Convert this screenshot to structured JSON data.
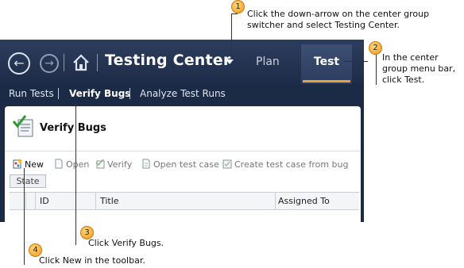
{
  "header": {
    "center_name": "Testing Center",
    "menu": [
      {
        "label": "Plan",
        "selected": false
      },
      {
        "label": "Test",
        "selected": true
      }
    ]
  },
  "subnav": {
    "items": [
      {
        "label": "Run Tests",
        "active": false
      },
      {
        "label": "Verify Bugs",
        "active": true
      },
      {
        "label": "Analyze Test Runs",
        "active": false
      }
    ]
  },
  "panel": {
    "title": "Verify Bugs",
    "toolbar": [
      {
        "label": "New",
        "icon": "new-icon",
        "enabled": true
      },
      {
        "label": "Open",
        "icon": "open-icon",
        "enabled": false
      },
      {
        "label": "Verify",
        "icon": "verify-icon",
        "enabled": false
      },
      {
        "label": "Open test case",
        "icon": "open-test-case-icon",
        "enabled": false
      },
      {
        "label": "Create test case from bug",
        "icon": "create-test-case-icon",
        "enabled": false
      }
    ],
    "state_tab": "State",
    "columns": [
      "ID",
      "Title",
      "Assigned To"
    ]
  },
  "callouts": [
    {
      "number": "1",
      "text": "Click the down-arrow on the center group switcher and select Testing Center."
    },
    {
      "number": "2",
      "text": "In the center group menu bar, click Test."
    },
    {
      "number": "3",
      "text": "Click Verify Bugs."
    },
    {
      "number": "4",
      "text": "Click New in the toolbar."
    }
  ],
  "colors": {
    "accent_underline": "#e8a33b",
    "header_bg": "#1e2c48",
    "callout_badge": "#f19a1a"
  }
}
